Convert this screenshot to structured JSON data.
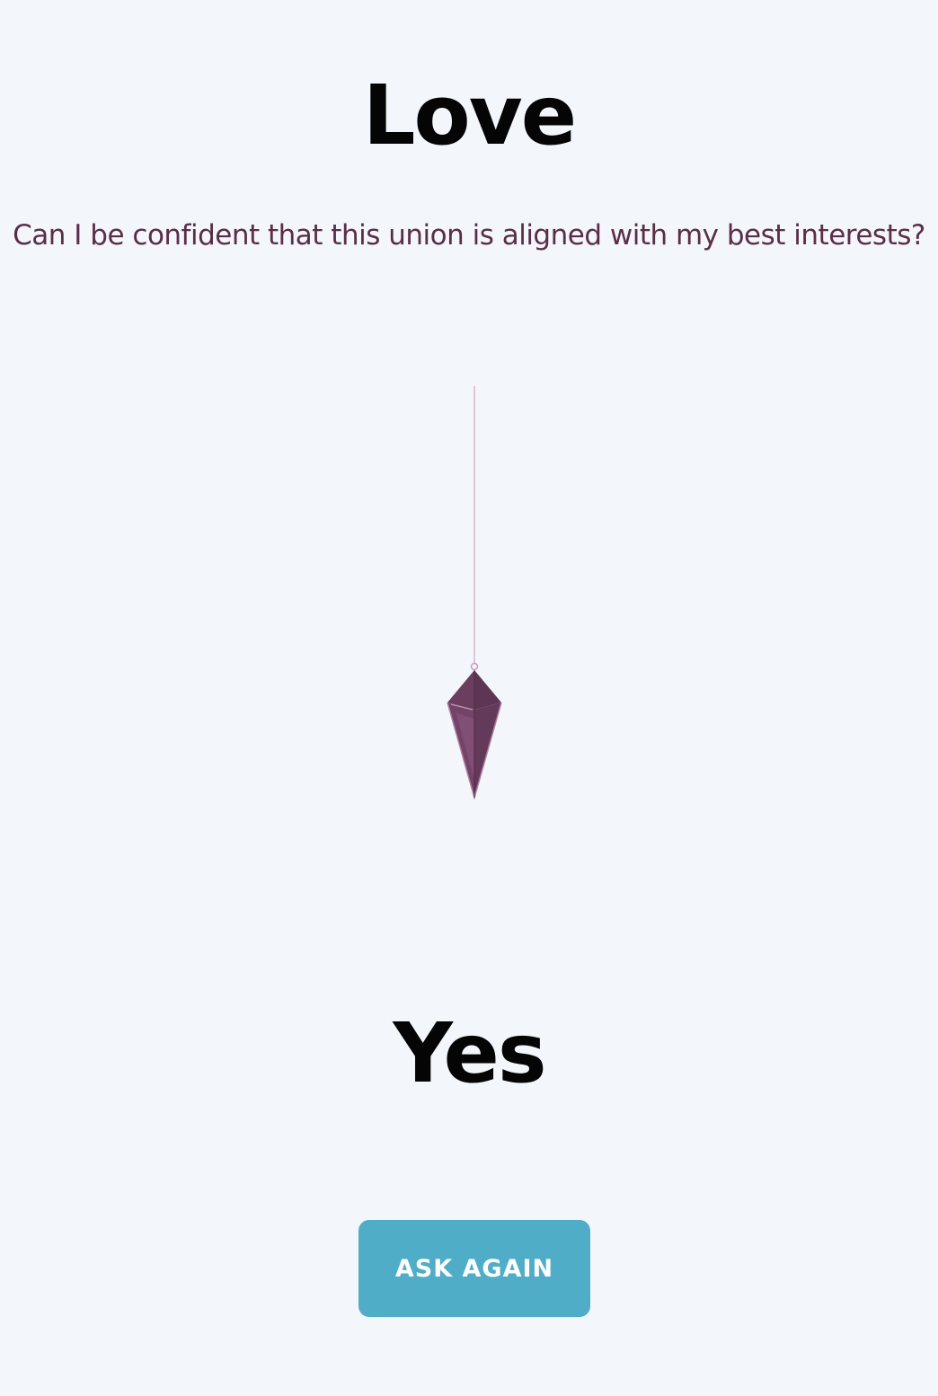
{
  "header": {
    "title": "Love"
  },
  "question": {
    "text": "Can I be confident that this union is aligned with my best interests?"
  },
  "pendulum": {
    "icon": "pendulum-crystal-icon",
    "colors": {
      "string": "#d9b3cc",
      "crystal_dark": "#5e3554",
      "crystal_mid": "#744468",
      "crystal_light": "#8c5a80",
      "crystal_edge": "#b07fa4"
    }
  },
  "answer": {
    "text": "Yes"
  },
  "actions": {
    "ask_again_label": "ASK AGAIN"
  },
  "theme": {
    "background": "#f3f7fb",
    "button_color": "#4fadc8",
    "question_color": "#5a2e49"
  }
}
